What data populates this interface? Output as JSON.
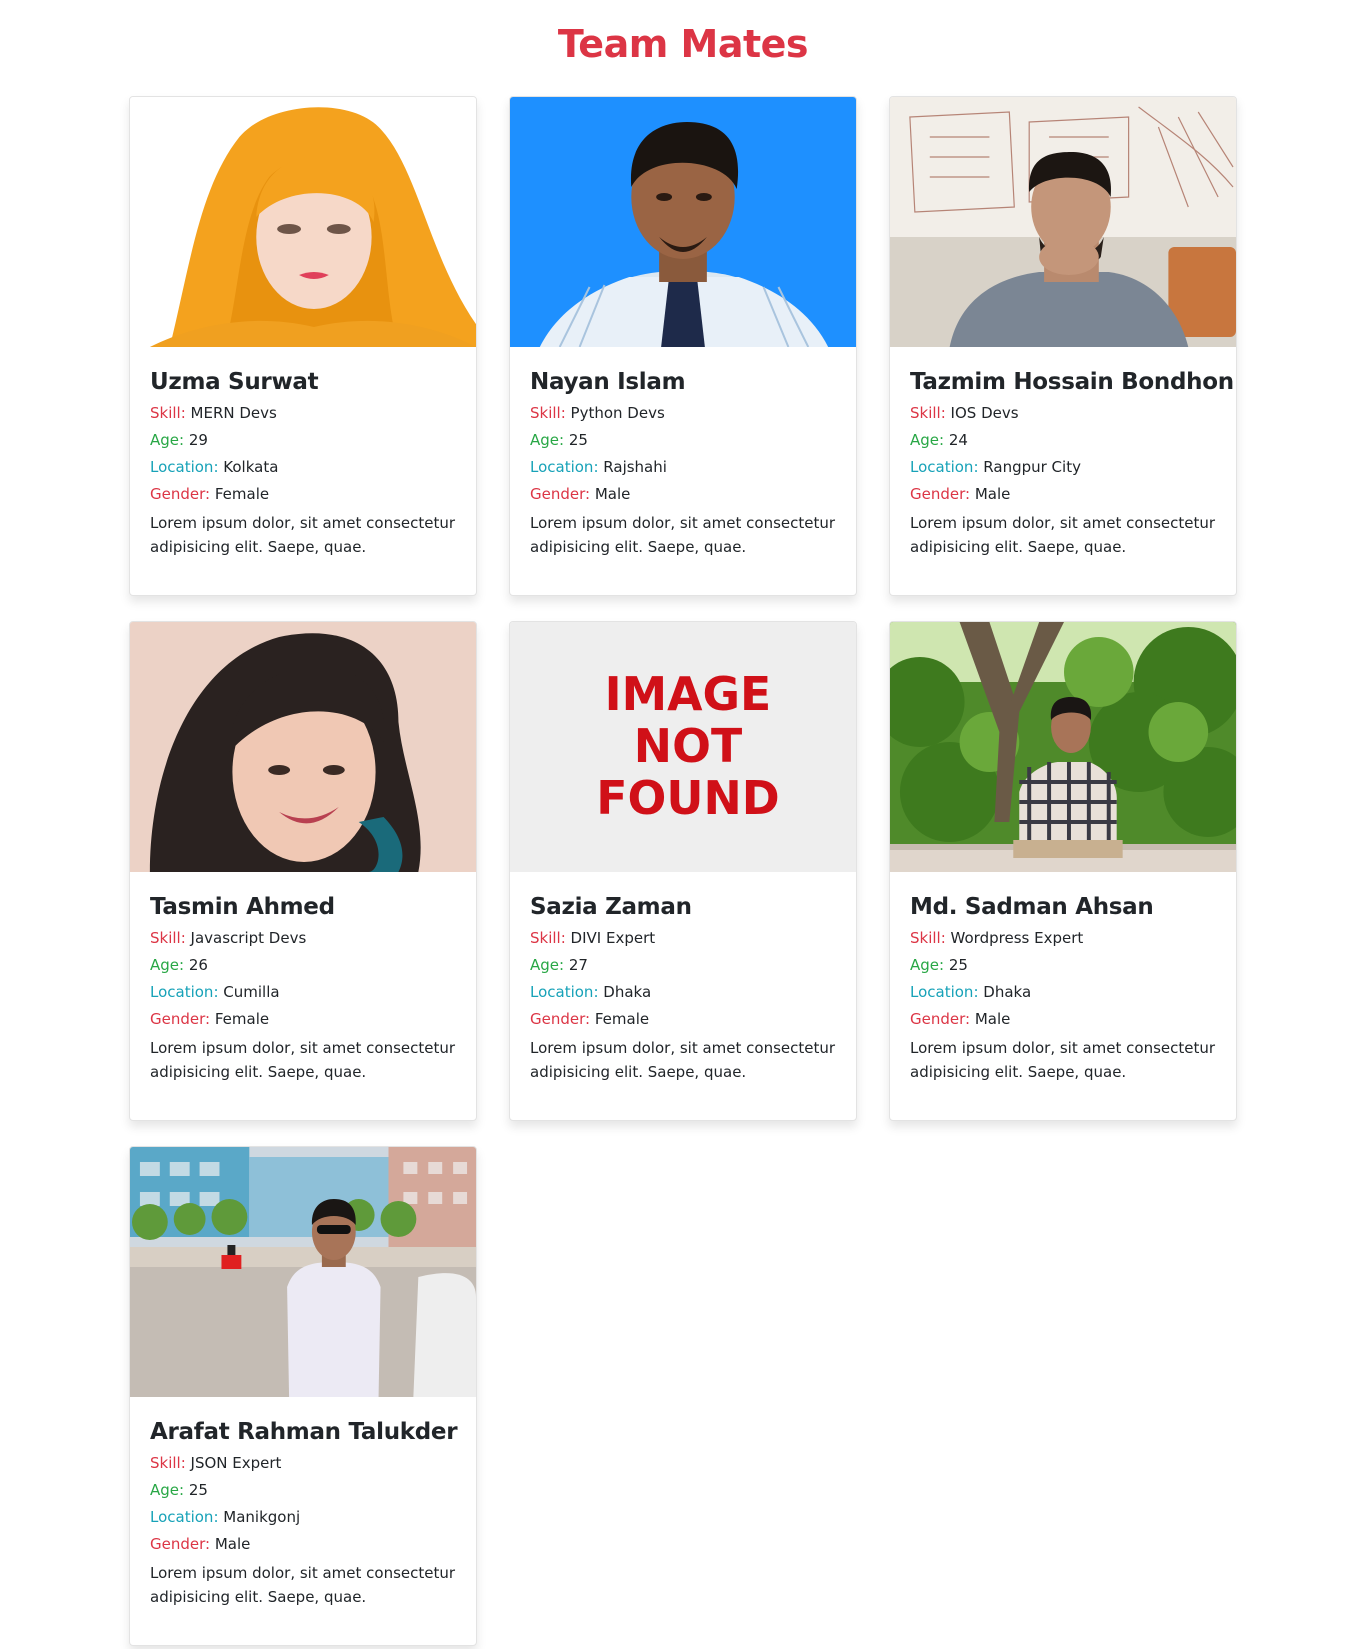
{
  "page": {
    "title": "Team Mates"
  },
  "labels": {
    "skill": "Skill:",
    "age": "Age:",
    "location": "Location:",
    "gender": "Gender:"
  },
  "colors": {
    "title": "#dc3545",
    "skill_label": "#dc3545",
    "age_label": "#28a745",
    "location_label": "#17a2b8",
    "gender_label": "#dc3545"
  },
  "cards": [
    {
      "name": "Uzma Surwat",
      "skill": "MERN Devs",
      "age": "29",
      "location": "Kolkata",
      "gender": "Female",
      "description": "Lorem ipsum dolor, sit amet consectetur adipisicing elit. Saepe, quae.",
      "photo": "portrait-woman-orange-hijab"
    },
    {
      "name": "Nayan Islam",
      "skill": "Python Devs",
      "age": "25",
      "location": "Rajshahi",
      "gender": "Male",
      "description": "Lorem ipsum dolor, sit amet consectetur adipisicing elit. Saepe, quae.",
      "photo": "portrait-man-blue-background-tie"
    },
    {
      "name": "Tazmim Hossain Bondhon",
      "skill": "IOS Devs",
      "age": "24",
      "location": "Rangpur City",
      "gender": "Male",
      "description": "Lorem ipsum dolor, sit amet consectetur adipisicing elit. Saepe, quae.",
      "photo": "portrait-man-sketch-wall"
    },
    {
      "name": "Tasmin Ahmed",
      "skill": "Javascript Devs",
      "age": "26",
      "location": "Cumilla",
      "gender": "Female",
      "description": "Lorem ipsum dolor, sit amet consectetur adipisicing elit. Saepe, quae.",
      "photo": "portrait-woman-selfie"
    },
    {
      "name": "Sazia Zaman",
      "skill": "DIVI Expert",
      "age": "27",
      "location": "Dhaka",
      "gender": "Female",
      "description": "Lorem ipsum dolor, sit amet consectetur adipisicing elit. Saepe, quae.",
      "photo": "image-not-found-placeholder",
      "photo_text": [
        "IMAGE",
        "NOT",
        "FOUND"
      ]
    },
    {
      "name": "Md. Sadman Ahsan",
      "skill": "Wordpress Expert",
      "age": "25",
      "location": "Dhaka",
      "gender": "Male",
      "description": "Lorem ipsum dolor, sit amet consectetur adipisicing elit. Saepe, quae.",
      "photo": "portrait-man-park-tree"
    },
    {
      "name": "Arafat Rahman Talukder",
      "skill": "JSON Expert",
      "age": "25",
      "location": "Manikgonj",
      "gender": "Male",
      "description": "Lorem ipsum dolor, sit amet consectetur adipisicing elit. Saepe, quae.",
      "photo": "portrait-man-street"
    }
  ]
}
